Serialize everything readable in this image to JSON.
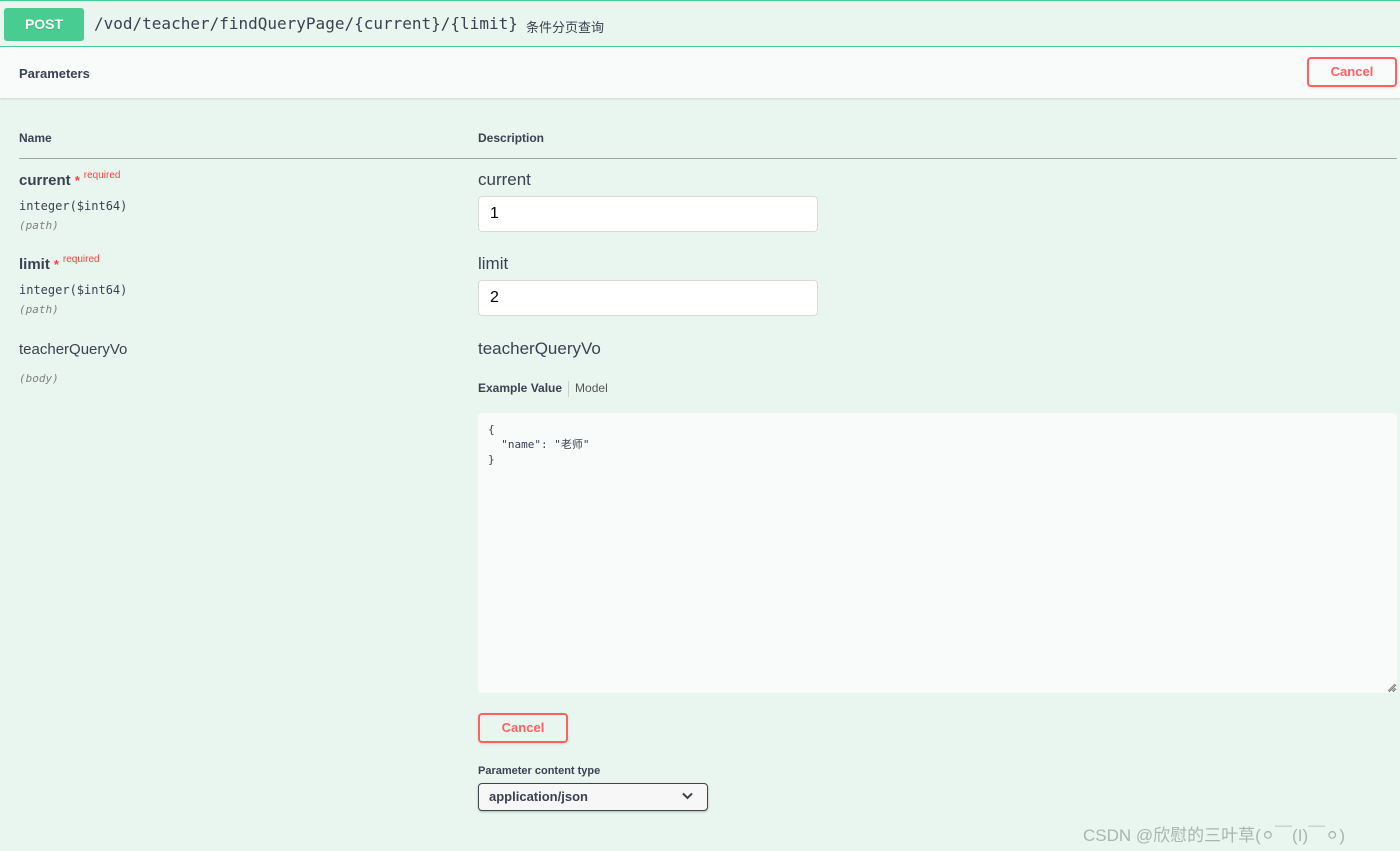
{
  "operation": {
    "method": "POST",
    "path": "/vod/teacher/findQueryPage/{current}/{limit}",
    "summary": "条件分页查询"
  },
  "parameters_header": {
    "title": "Parameters",
    "cancel_label": "Cancel"
  },
  "columns": {
    "name": "Name",
    "description": "Description"
  },
  "params": [
    {
      "name": "current",
      "star": "*",
      "required_label": "required",
      "type": "integer($int64)",
      "in": "(path)",
      "label": "current",
      "value": "1"
    },
    {
      "name": "limit",
      "star": "*",
      "required_label": "required",
      "type": "integer($int64)",
      "in": "(path)",
      "label": "limit",
      "value": "2"
    },
    {
      "name": "teacherQueryVo",
      "in": "(body)",
      "label": "teacherQueryVo",
      "tabs": {
        "example": "Example Value",
        "model": "Model"
      },
      "body_value": "{\n  \"name\": \"老师\"\n}"
    }
  ],
  "body_cancel_label": "Cancel",
  "content_type": {
    "label": "Parameter content type",
    "selected": "application/json"
  },
  "watermark": "CSDN @欣慰的三叶草(⚪￣(I)￣⚪)",
  "colors": {
    "post": "#49cc90",
    "cancel": "#ff6060",
    "required": "#ff4040",
    "background": "#e8f6ef"
  }
}
